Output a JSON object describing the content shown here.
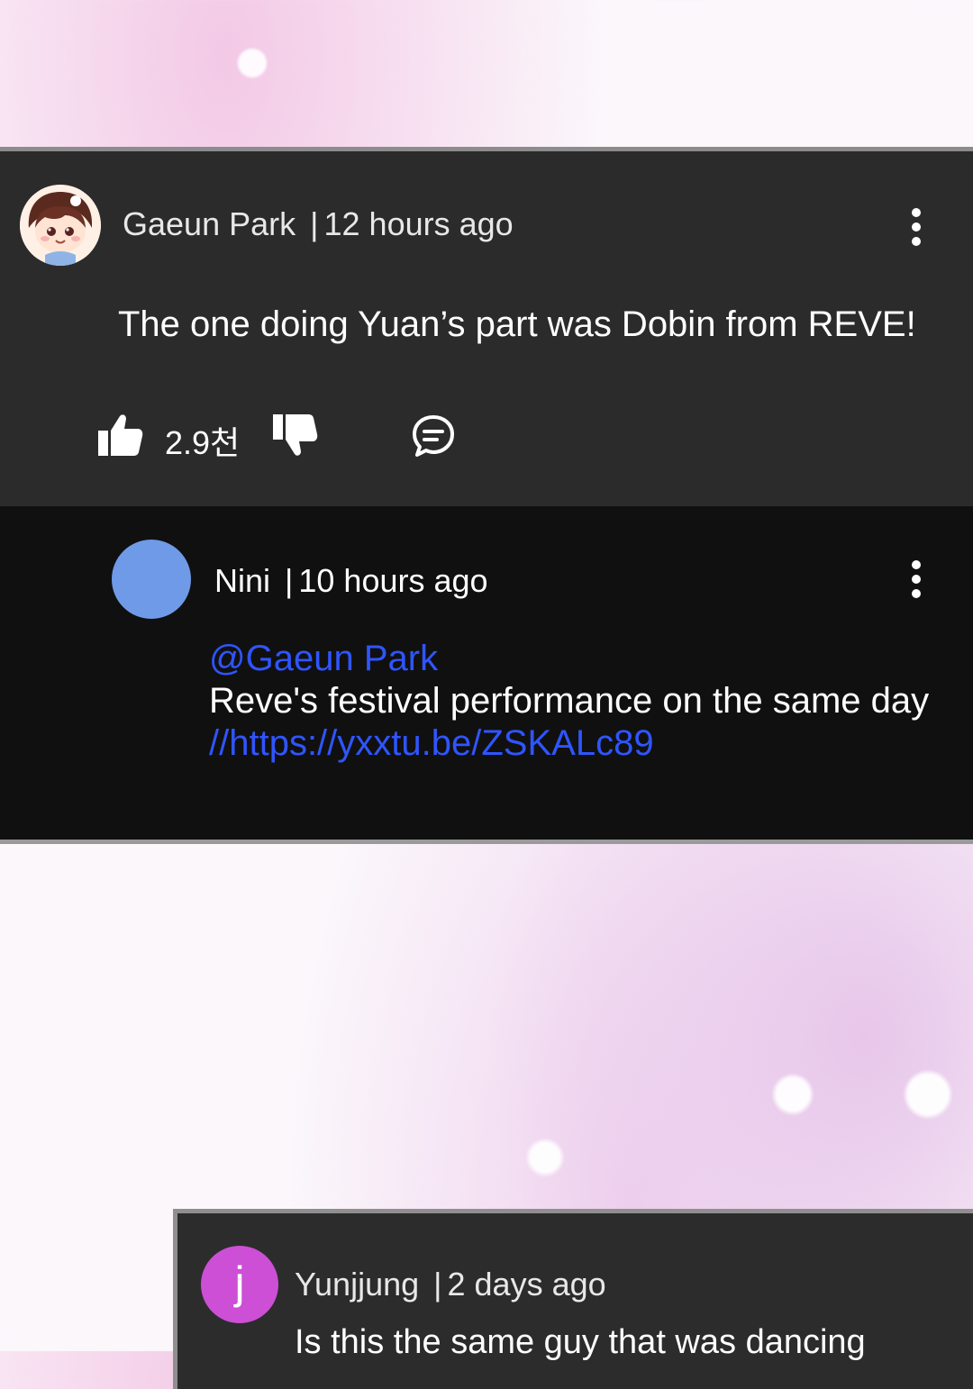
{
  "comment_main": {
    "author": "Gaeun Park",
    "separator": "|",
    "time": "12 hours ago",
    "text": "The one doing Yuan’s part was Dobin from REVE!",
    "like_count": "2.9천"
  },
  "comment_reply": {
    "author": "Nini",
    "separator": "|",
    "time": "10 hours ago",
    "mention": "@Gaeun Park",
    "text": "Reve's festival performance on the same day",
    "link": "//https://yxxtu.be/ZSKALc89",
    "avatar_color": "#6f9ae8"
  },
  "comment_third": {
    "avatar_letter": "j",
    "avatar_color": "#cc4fd6",
    "author": "Yunjjung",
    "separator": "|",
    "time": "2 days ago",
    "text": "Is this the same guy that was dancing"
  },
  "colors": {
    "mention": "#2f55ff",
    "card_dark": "#2b2b2b",
    "card_black": "#101010"
  }
}
